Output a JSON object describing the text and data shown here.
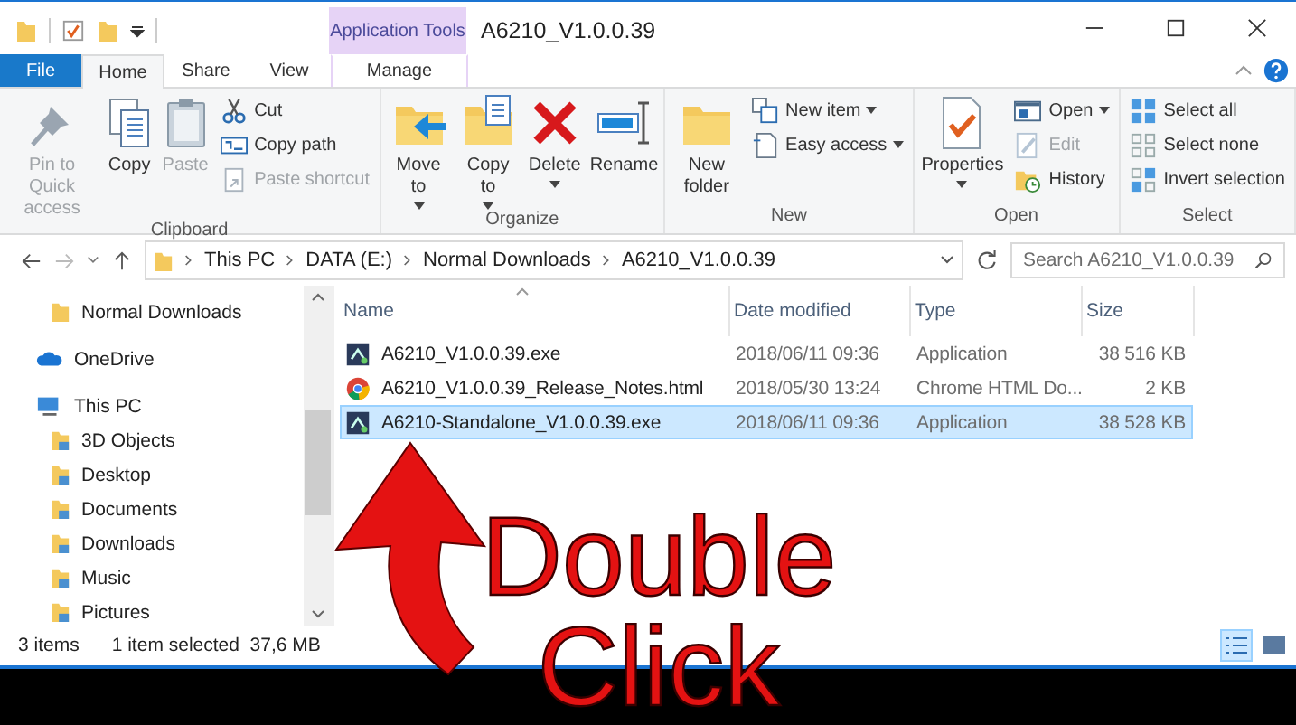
{
  "window": {
    "title": "A6210_V1.0.0.39",
    "contextual_header": "Application Tools"
  },
  "tabs": [
    {
      "label": "File",
      "kind": "file",
      "selected": false
    },
    {
      "label": "Home",
      "kind": "normal",
      "selected": true
    },
    {
      "label": "Share",
      "kind": "normal",
      "selected": false
    },
    {
      "label": "View",
      "kind": "normal",
      "selected": false
    },
    {
      "label": "Manage",
      "kind": "contextual",
      "selected": false
    }
  ],
  "ribbon": {
    "groups": [
      {
        "label": "Clipboard",
        "large": [
          {
            "label": "Pin to Quick access",
            "disabled": true,
            "dropdown": false
          },
          {
            "label": "Copy",
            "disabled": false,
            "dropdown": false
          },
          {
            "label": "Paste",
            "disabled": true,
            "dropdown": false
          }
        ],
        "small": [
          {
            "label": "Cut",
            "disabled": false,
            "dropdown": false
          },
          {
            "label": "Copy path",
            "disabled": false,
            "dropdown": false
          },
          {
            "label": "Paste shortcut",
            "disabled": true,
            "dropdown": false
          }
        ]
      },
      {
        "label": "Organize",
        "large": [
          {
            "label": "Move to",
            "disabled": false,
            "dropdown": true
          },
          {
            "label": "Copy to",
            "disabled": false,
            "dropdown": true
          },
          {
            "label": "Delete",
            "disabled": false,
            "dropdown": true
          },
          {
            "label": "Rename",
            "disabled": false,
            "dropdown": false
          }
        ]
      },
      {
        "label": "New",
        "large": [
          {
            "label": "New folder",
            "disabled": false,
            "dropdown": false
          }
        ],
        "small": [
          {
            "label": "New item",
            "disabled": false,
            "dropdown": true
          },
          {
            "label": "Easy access",
            "disabled": false,
            "dropdown": true
          }
        ]
      },
      {
        "label": "Open",
        "large": [
          {
            "label": "Properties",
            "disabled": false,
            "dropdown": true
          }
        ],
        "small": [
          {
            "label": "Open",
            "disabled": false,
            "dropdown": true
          },
          {
            "label": "Edit",
            "disabled": true,
            "dropdown": false
          },
          {
            "label": "History",
            "disabled": false,
            "dropdown": false
          }
        ]
      },
      {
        "label": "Select",
        "small": [
          {
            "label": "Select all",
            "disabled": false,
            "dropdown": false
          },
          {
            "label": "Select none",
            "disabled": false,
            "dropdown": false
          },
          {
            "label": "Invert selection",
            "disabled": false,
            "dropdown": false
          }
        ]
      }
    ]
  },
  "address": {
    "path": [
      "This PC",
      "DATA (E:)",
      "Normal Downloads",
      "A6210_V1.0.0.39"
    ],
    "search": {
      "placeholder": "Search A6210_V1.0.0.39"
    }
  },
  "sidebar": {
    "items": [
      {
        "label": "Normal Downloads",
        "kind": "folder"
      },
      {
        "label": "OneDrive",
        "kind": "cloud"
      },
      {
        "label": "This PC",
        "kind": "computer",
        "children": [
          {
            "label": "3D Objects",
            "kind": "folder"
          },
          {
            "label": "Desktop",
            "kind": "folder"
          },
          {
            "label": "Documents",
            "kind": "folder"
          },
          {
            "label": "Downloads",
            "kind": "folder"
          },
          {
            "label": "Music",
            "kind": "folder"
          },
          {
            "label": "Pictures",
            "kind": "folder"
          }
        ]
      }
    ]
  },
  "table": {
    "columns": [
      "Name",
      "Date modified",
      "Type",
      "Size"
    ],
    "rows": [
      {
        "name": "A6210_V1.0.0.39.exe",
        "date": "2018/06/11 09:36",
        "type": "Application",
        "size": "38 516 KB",
        "kind": "exe",
        "selected": false
      },
      {
        "name": "A6210_V1.0.0.39_Release_Notes.html",
        "date": "2018/05/30 13:24",
        "type": "Chrome HTML Do...",
        "size": "2 KB",
        "kind": "html",
        "selected": false
      },
      {
        "name": "A6210-Standalone_V1.0.0.39.exe",
        "date": "2018/06/11 09:36",
        "type": "Application",
        "size": "38 528 KB",
        "kind": "exe",
        "selected": true
      }
    ]
  },
  "status_bar": {
    "count": "3 items",
    "selection": "1 item selected  37,6 MB",
    "views": [
      {
        "selected": true
      },
      {
        "selected": false
      }
    ]
  },
  "annotation": {
    "text": "Double Click"
  }
}
